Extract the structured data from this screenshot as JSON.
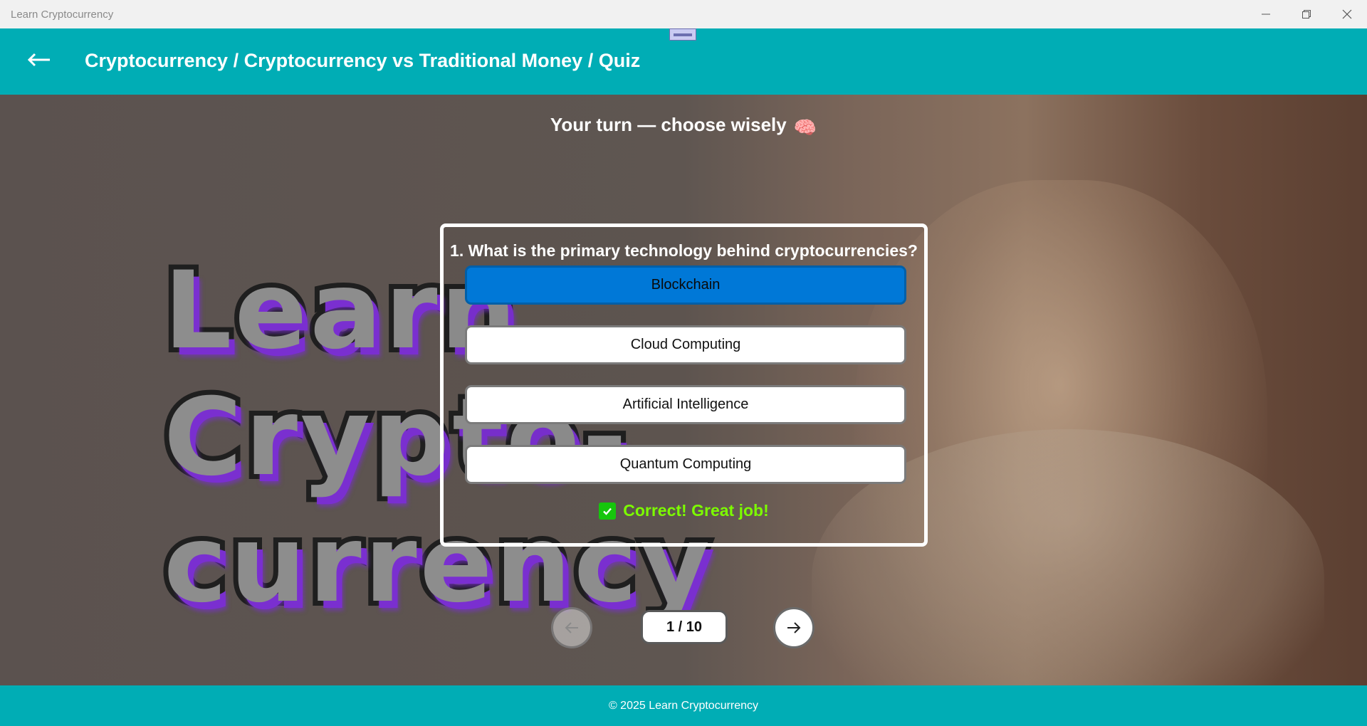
{
  "window": {
    "title": "Learn Cryptocurrency",
    "controls": [
      "minimize-icon",
      "restore-icon",
      "close-icon"
    ]
  },
  "header": {
    "back_icon": "arrow-left-icon",
    "breadcrumb": "Cryptocurrency / Cryptocurrency vs Traditional Money / Quiz"
  },
  "background": {
    "logo_lines": [
      "Learn",
      "Crypto-",
      "currency"
    ]
  },
  "main": {
    "heading": "Your turn — choose wisely",
    "heading_icon": "🧠"
  },
  "quiz": {
    "question": "1. What is the primary technology behind cryptocurrencies?",
    "options": [
      {
        "label": "Blockchain",
        "selected": true
      },
      {
        "label": "Cloud Computing",
        "selected": false
      },
      {
        "label": "Artificial Intelligence",
        "selected": false
      },
      {
        "label": "Quantum Computing",
        "selected": false
      }
    ],
    "feedback": "Correct! Great job!",
    "feedback_icon": "check-icon",
    "colors": {
      "selected": "#0078d7",
      "feedback": "#7cfc00",
      "accent": "#00adb5"
    }
  },
  "pager": {
    "page_text": "1 / 10",
    "prev_icon": "arrow-left-icon",
    "next_icon": "arrow-right-icon",
    "prev_enabled": false
  },
  "footer": {
    "text": "© 2025 Learn Cryptocurrency"
  }
}
